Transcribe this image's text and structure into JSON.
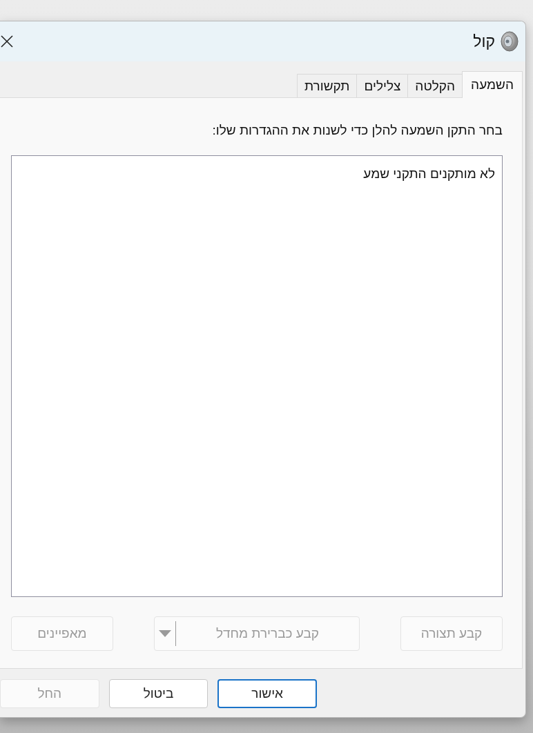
{
  "window": {
    "title": "קול"
  },
  "tabs": [
    {
      "label": "השמעה",
      "selected": true
    },
    {
      "label": "הקלטה",
      "selected": false
    },
    {
      "label": "צלילים",
      "selected": false
    },
    {
      "label": "תקשורת",
      "selected": false
    }
  ],
  "instruction": "בחר התקן השמעה להלן כדי לשנות את ההגדרות שלו:",
  "device_list": {
    "empty_message": "לא מותקנים התקני שמע"
  },
  "device_buttons": [
    {
      "label": "קבע תצורה",
      "kind": "plain",
      "disabled": true
    },
    {
      "label": "קבע כברירת מחדל",
      "kind": "split",
      "disabled": true
    },
    {
      "label": "מאפיינים",
      "kind": "plain",
      "disabled": true
    }
  ],
  "dialog_buttons": [
    {
      "label": "אישור",
      "default": true,
      "disabled": false
    },
    {
      "label": "ביטול",
      "default": false,
      "disabled": false
    },
    {
      "label": "החל",
      "default": false,
      "disabled": true
    }
  ]
}
